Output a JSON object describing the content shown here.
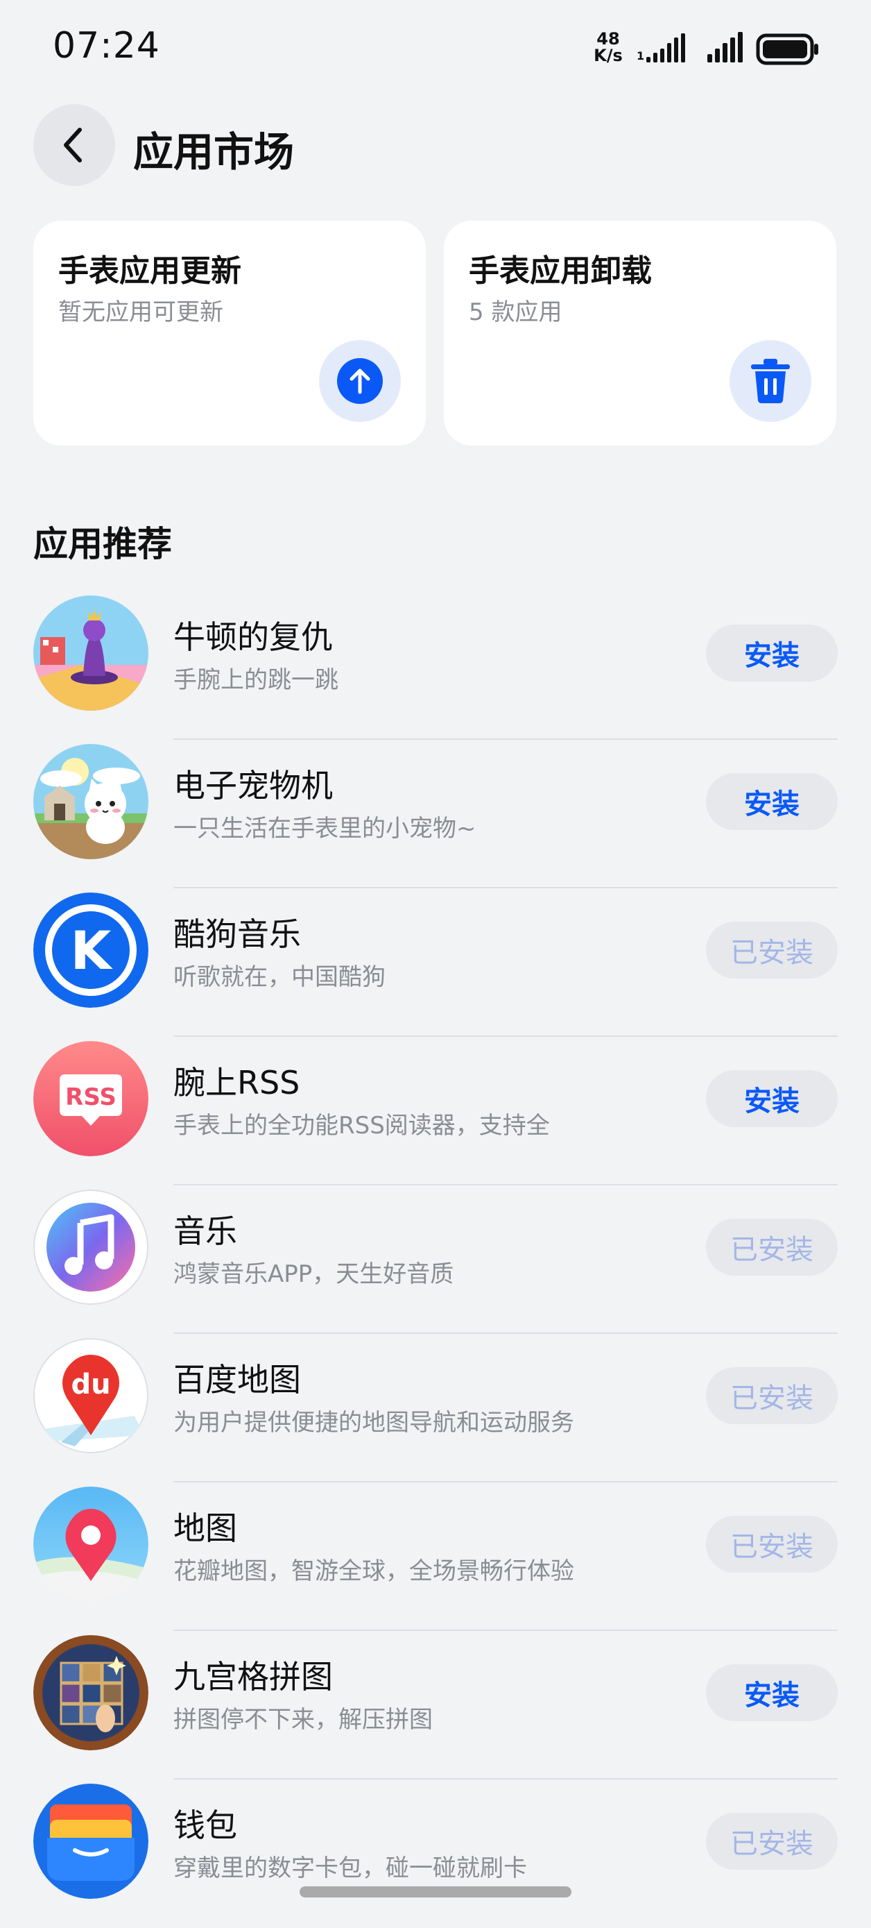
{
  "status": {
    "time": "07:24",
    "net_speed_value": "48",
    "net_speed_unit": "K/s"
  },
  "header": {
    "title": "应用市场"
  },
  "cards": {
    "update": {
      "title": "手表应用更新",
      "subtitle": "暂无应用可更新",
      "icon": "arrow-up-icon"
    },
    "uninstall": {
      "title": "手表应用卸载",
      "subtitle": "5 款应用",
      "icon": "trash-icon"
    }
  },
  "section": {
    "title": "应用推荐"
  },
  "apps": [
    {
      "name": "牛顿的复仇",
      "desc": "手腕上的跳一跳",
      "button": "安装",
      "installed": false,
      "icon": "chess-game-icon"
    },
    {
      "name": "电子宠物机",
      "desc": "一只生活在手表里的小宠物~",
      "button": "安装",
      "installed": false,
      "icon": "pet-cat-icon"
    },
    {
      "name": "酷狗音乐",
      "desc": "听歌就在，中国酷狗",
      "button": "已安装",
      "installed": true,
      "icon": "kugou-icon"
    },
    {
      "name": "腕上RSS",
      "desc": "手表上的全功能RSS阅读器，支持全",
      "button": "安装",
      "installed": false,
      "icon": "rss-icon"
    },
    {
      "name": "音乐",
      "desc": "鸿蒙音乐APP，天生好音质",
      "button": "已安装",
      "installed": true,
      "icon": "music-note-icon"
    },
    {
      "name": "百度地图",
      "desc": "为用户提供便捷的地图导航和运动服务",
      "button": "已安装",
      "installed": true,
      "icon": "baidu-map-icon"
    },
    {
      "name": "地图",
      "desc": "花瓣地图，智游全球，全场景畅行体验",
      "button": "已安装",
      "installed": true,
      "icon": "map-pin-icon"
    },
    {
      "name": "九宫格拼图",
      "desc": "拼图停不下来，解压拼图",
      "button": "安装",
      "installed": false,
      "icon": "puzzle-icon"
    },
    {
      "name": "钱包",
      "desc": "穿戴里的数字卡包，碰一碰就刷卡",
      "button": "已安装",
      "installed": true,
      "icon": "wallet-icon"
    }
  ],
  "icon_texts": {
    "rss": "RSS",
    "baidu": "du",
    "kugou": "K"
  },
  "colors": {
    "accent": "#0a59f7",
    "installed_text": "#a4b6e6",
    "background": "#f1f3f5"
  }
}
